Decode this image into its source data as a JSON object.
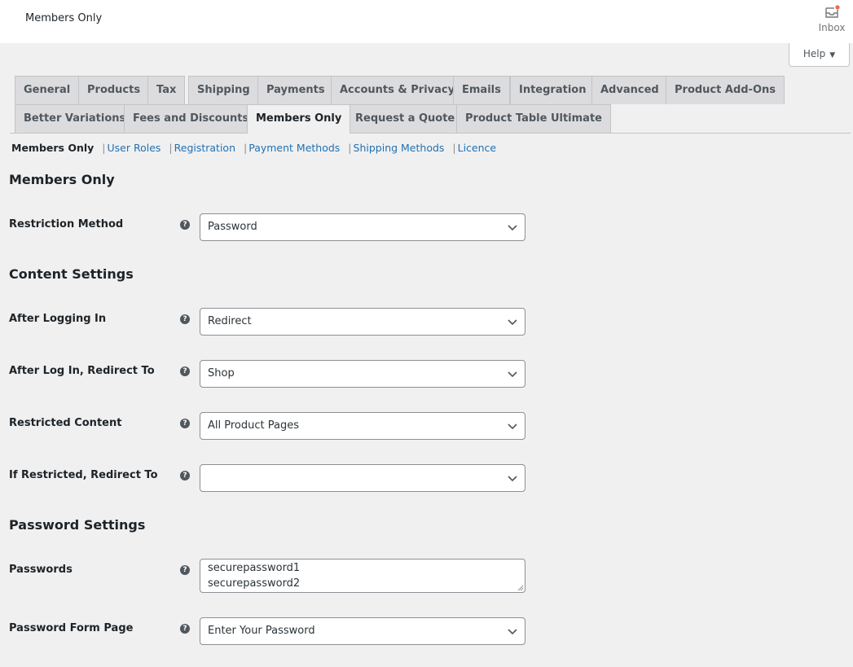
{
  "header": {
    "title": "Members Only",
    "inbox_label": "Inbox",
    "inbox_badge_color": "#d63638",
    "help_label": "Help"
  },
  "tabs": [
    {
      "label": "General",
      "active": false
    },
    {
      "label": "Products",
      "active": false
    },
    {
      "label": "Tax",
      "active": false
    },
    {
      "label": "Shipping",
      "active": false
    },
    {
      "label": "Payments",
      "active": false
    },
    {
      "label": "Accounts & Privacy",
      "active": false
    },
    {
      "label": "Emails",
      "active": false
    },
    {
      "label": "Integration",
      "active": false
    },
    {
      "label": "Advanced",
      "active": false
    },
    {
      "label": "Product Add-Ons",
      "active": false
    },
    {
      "label": "Better Variations",
      "active": false
    },
    {
      "label": "Fees and Discounts",
      "active": false
    },
    {
      "label": "Members Only",
      "active": true
    },
    {
      "label": "Request a Quote",
      "active": false
    },
    {
      "label": "Product Table Ultimate",
      "active": false
    }
  ],
  "subnav": {
    "current": "Members Only",
    "links": [
      "User Roles",
      "Registration",
      "Payment Methods",
      "Shipping Methods",
      "Licence"
    ],
    "link_color": "#2271b1"
  },
  "sections": {
    "members_only": {
      "title": "Members Only",
      "restriction_method": {
        "label": "Restriction Method",
        "value": "Password"
      }
    },
    "content_settings": {
      "title": "Content Settings",
      "after_logging_in": {
        "label": "After Logging In",
        "value": "Redirect"
      },
      "after_login_redirect": {
        "label": "After Log In, Redirect To",
        "value": "Shop"
      },
      "restricted_content": {
        "label": "Restricted Content",
        "value": "All Product Pages"
      },
      "if_restricted_redirect": {
        "label": "If Restricted, Redirect To",
        "value": ""
      }
    },
    "password_settings": {
      "title": "Password Settings",
      "passwords": {
        "label": "Passwords",
        "lines": [
          "securepassword1",
          "securepassword2"
        ]
      },
      "password_form_page": {
        "label": "Password Form Page",
        "value": "Enter Your Password"
      }
    }
  },
  "help_tip_glyph": "?"
}
